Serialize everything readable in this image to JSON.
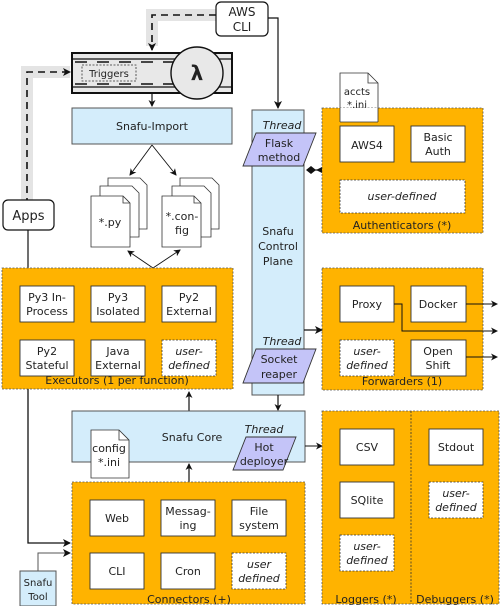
{
  "colors": {
    "group_fill": "#ffb300",
    "blue_fill": "#d4edfb",
    "thread_fill": "#c4c4f8",
    "gray_path": "#e4e4e4",
    "box_fill": "#ffffff",
    "line": "#222222"
  },
  "aws_cli": {
    "line1": "AWS",
    "line2": "CLI"
  },
  "lambda": {
    "triggers_label": "Triggers",
    "symbol": "λ"
  },
  "snafu_import": {
    "label": "Snafu-Import"
  },
  "apps": {
    "label": "Apps"
  },
  "files": {
    "py": "*.py",
    "config_line1": "*.con-",
    "config_line2": "fig",
    "accts_line1": "accts",
    "accts_line2": "*.ini",
    "core_config_line1": "config",
    "core_config_line2": "*.ini"
  },
  "control_plane": {
    "line1": "Snafu",
    "line2": "Control",
    "line3": "Plane",
    "thread_label": "Thread",
    "flask_line1": "Flask",
    "flask_line2": "method",
    "reaper_line1": "Socket",
    "reaper_line2": "reaper"
  },
  "authenticators": {
    "title": "Authenticators (*)",
    "items": [
      {
        "line1": "AWS4",
        "line2": ""
      },
      {
        "line1": "Basic",
        "line2": "Auth"
      }
    ],
    "user_defined": "user-defined"
  },
  "executors": {
    "title": "Executors (1 per function)",
    "items": [
      {
        "line1": "Py3 In-",
        "line2": "Process"
      },
      {
        "line1": "Py3",
        "line2": "Isolated"
      },
      {
        "line1": "Py2",
        "line2": "External"
      },
      {
        "line1": "Py2",
        "line2": "Stateful"
      },
      {
        "line1": "Java",
        "line2": "External"
      },
      {
        "line1": "user-",
        "line2": "defined"
      }
    ]
  },
  "forwarders": {
    "title": "Forwarders (1)",
    "items": [
      {
        "line1": "Proxy",
        "line2": ""
      },
      {
        "line1": "Docker",
        "line2": ""
      },
      {
        "line1": "user-",
        "line2": "defined"
      },
      {
        "line1": "Open",
        "line2": "Shift"
      }
    ]
  },
  "snafu_core": {
    "label": "Snafu Core",
    "thread_label": "Thread",
    "hot_line1": "Hot",
    "hot_line2": "deployer"
  },
  "loggers": {
    "title": "Loggers (*)",
    "items": [
      {
        "line1": "CSV",
        "line2": ""
      },
      {
        "line1": "SQlite",
        "line2": ""
      },
      {
        "line1": "user-",
        "line2": "defined"
      }
    ]
  },
  "debuggers": {
    "title": "Debuggers (*)",
    "items": [
      {
        "line1": "Stdout",
        "line2": ""
      },
      {
        "line1": "user-",
        "line2": "defined"
      }
    ]
  },
  "connectors": {
    "title": "Connectors (+)",
    "items": [
      {
        "line1": "Web",
        "line2": ""
      },
      {
        "line1": "Messag-",
        "line2": "ing"
      },
      {
        "line1": "File",
        "line2": "system"
      },
      {
        "line1": "CLI",
        "line2": ""
      },
      {
        "line1": "Cron",
        "line2": ""
      },
      {
        "line1": "user",
        "line2": "defined"
      }
    ]
  },
  "snafu_tool": {
    "line1": "Snafu",
    "line2": "Tool"
  }
}
